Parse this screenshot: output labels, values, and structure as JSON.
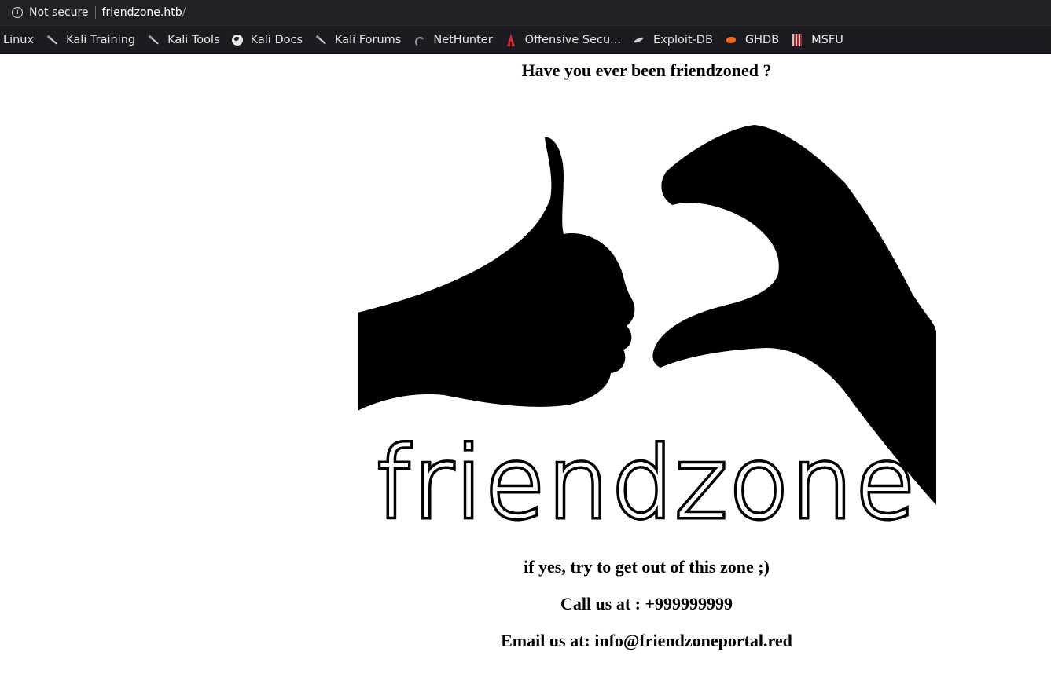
{
  "browser": {
    "security_label": "Not secure",
    "url_host": "friendzone.htb",
    "url_path": "/"
  },
  "bookmarks": [
    {
      "label": "Linux",
      "icon": "none"
    },
    {
      "label": "Kali Training",
      "icon": "kali-dragon-icon"
    },
    {
      "label": "Kali Tools",
      "icon": "kali-dragon-icon"
    },
    {
      "label": "Kali Docs",
      "icon": "globe-icon"
    },
    {
      "label": "Kali Forums",
      "icon": "kali-dragon-icon"
    },
    {
      "label": "NetHunter",
      "icon": "nethunter-icon"
    },
    {
      "label": "Offensive Secu...",
      "icon": "offensive-security-icon"
    },
    {
      "label": "Exploit-DB",
      "icon": "exploit-db-icon"
    },
    {
      "label": "GHDB",
      "icon": "ghdb-icon"
    },
    {
      "label": "MSFU",
      "icon": "msfu-icon"
    }
  ],
  "page": {
    "heading": "Have you ever been friendzoned ?",
    "hero_text": "friendzone",
    "tagline": "if yes, try to get out of this zone ;)",
    "call": "Call us at : +999999999",
    "email": "Email us at: info@friendzoneportal.red"
  }
}
